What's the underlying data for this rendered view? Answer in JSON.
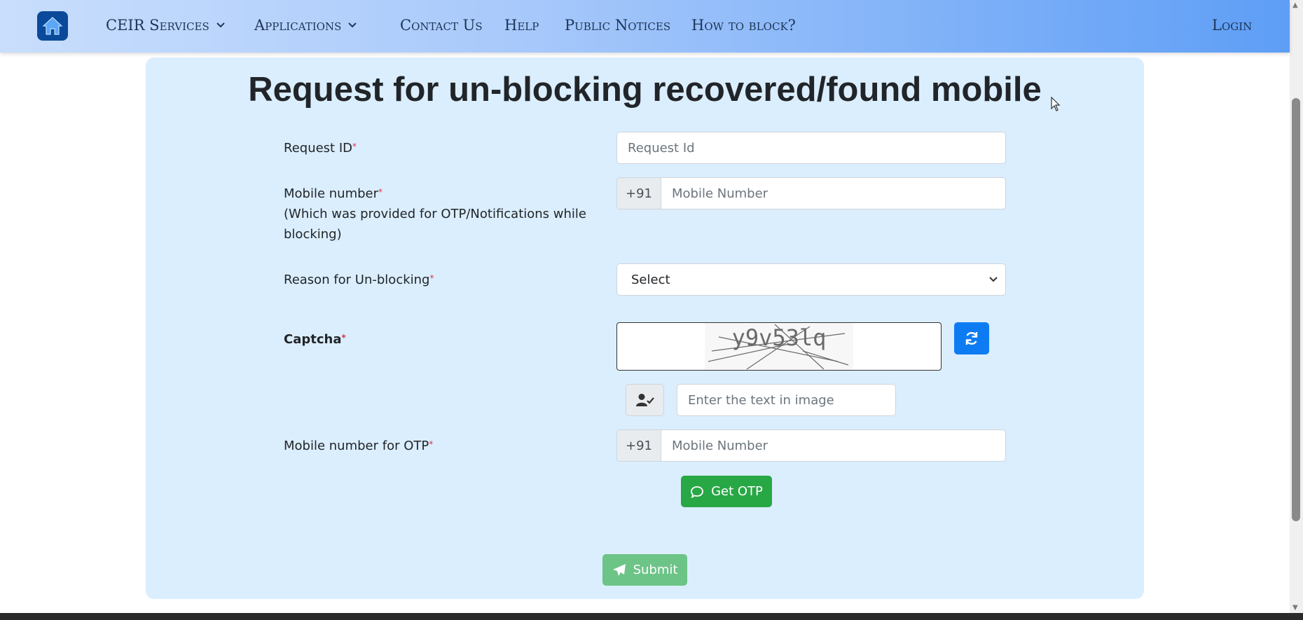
{
  "nav": {
    "items": [
      {
        "label": "CEIR Services",
        "dropdown": true
      },
      {
        "label": "Applications",
        "dropdown": true
      },
      {
        "label": "Contact Us"
      },
      {
        "label": "Help"
      },
      {
        "label": "Public Notices"
      },
      {
        "label": "How to block?"
      }
    ],
    "login": "Login",
    "dropdown_glyph": "⌄"
  },
  "form": {
    "title": "Request for un-blocking recovered/found mobile",
    "request_id": {
      "label": "Request ID",
      "placeholder": "Request Id"
    },
    "mobile": {
      "label": "Mobile number",
      "note": "(Which was provided for OTP/Notifications while blocking)",
      "prefix": "+91",
      "placeholder": "Mobile Number"
    },
    "reason": {
      "label": "Reason for Un-blocking",
      "selected": "Select"
    },
    "captcha": {
      "label": "Captcha",
      "image_text": "y9v53lq",
      "placeholder": "Enter the text in image"
    },
    "otp_mobile": {
      "label": "Mobile number for OTP",
      "prefix": "+91",
      "placeholder": "Mobile Number"
    },
    "required_mark": "*",
    "get_otp_label": "Get OTP",
    "submit_label": "Submit"
  },
  "colors": {
    "nav_gradient_end": "#5e9ef6",
    "card_background": "#dbeefe",
    "refresh_button": "#0d7cf2",
    "otp_button": "#28a745",
    "submit_button": "#6cc487",
    "required": "#dc3545"
  },
  "icons": [
    "home-icon",
    "chevron-down-icon",
    "refresh-icon",
    "user-check-icon",
    "chat-icon",
    "send-icon",
    "mouse-cursor-icon"
  ]
}
